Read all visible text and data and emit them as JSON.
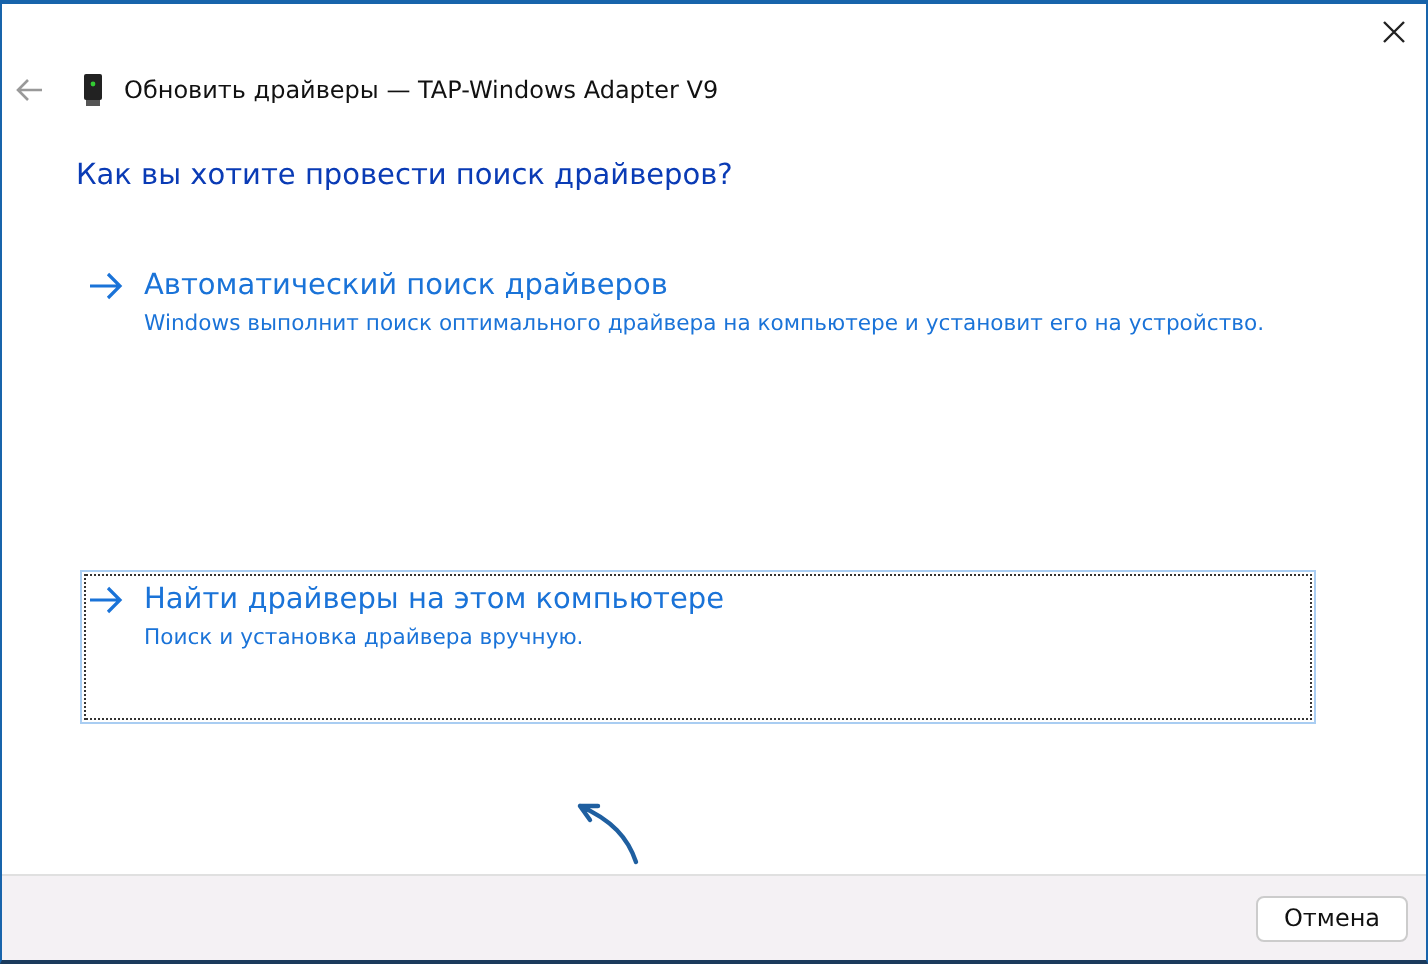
{
  "window": {
    "title": "Обновить драйверы — TAP-Windows Adapter V9"
  },
  "heading": "Как вы хотите провести поиск драйверов?",
  "options": [
    {
      "title": "Автоматический поиск драйверов",
      "description": "Windows выполнит поиск оптимального драйвера на компьютере и установит его на устройство.",
      "selected": false
    },
    {
      "title": "Найти драйверы на этом компьютере",
      "description": "Поиск и установка драйвера вручную.",
      "selected": true
    }
  ],
  "buttons": [
    "Отмена"
  ]
}
